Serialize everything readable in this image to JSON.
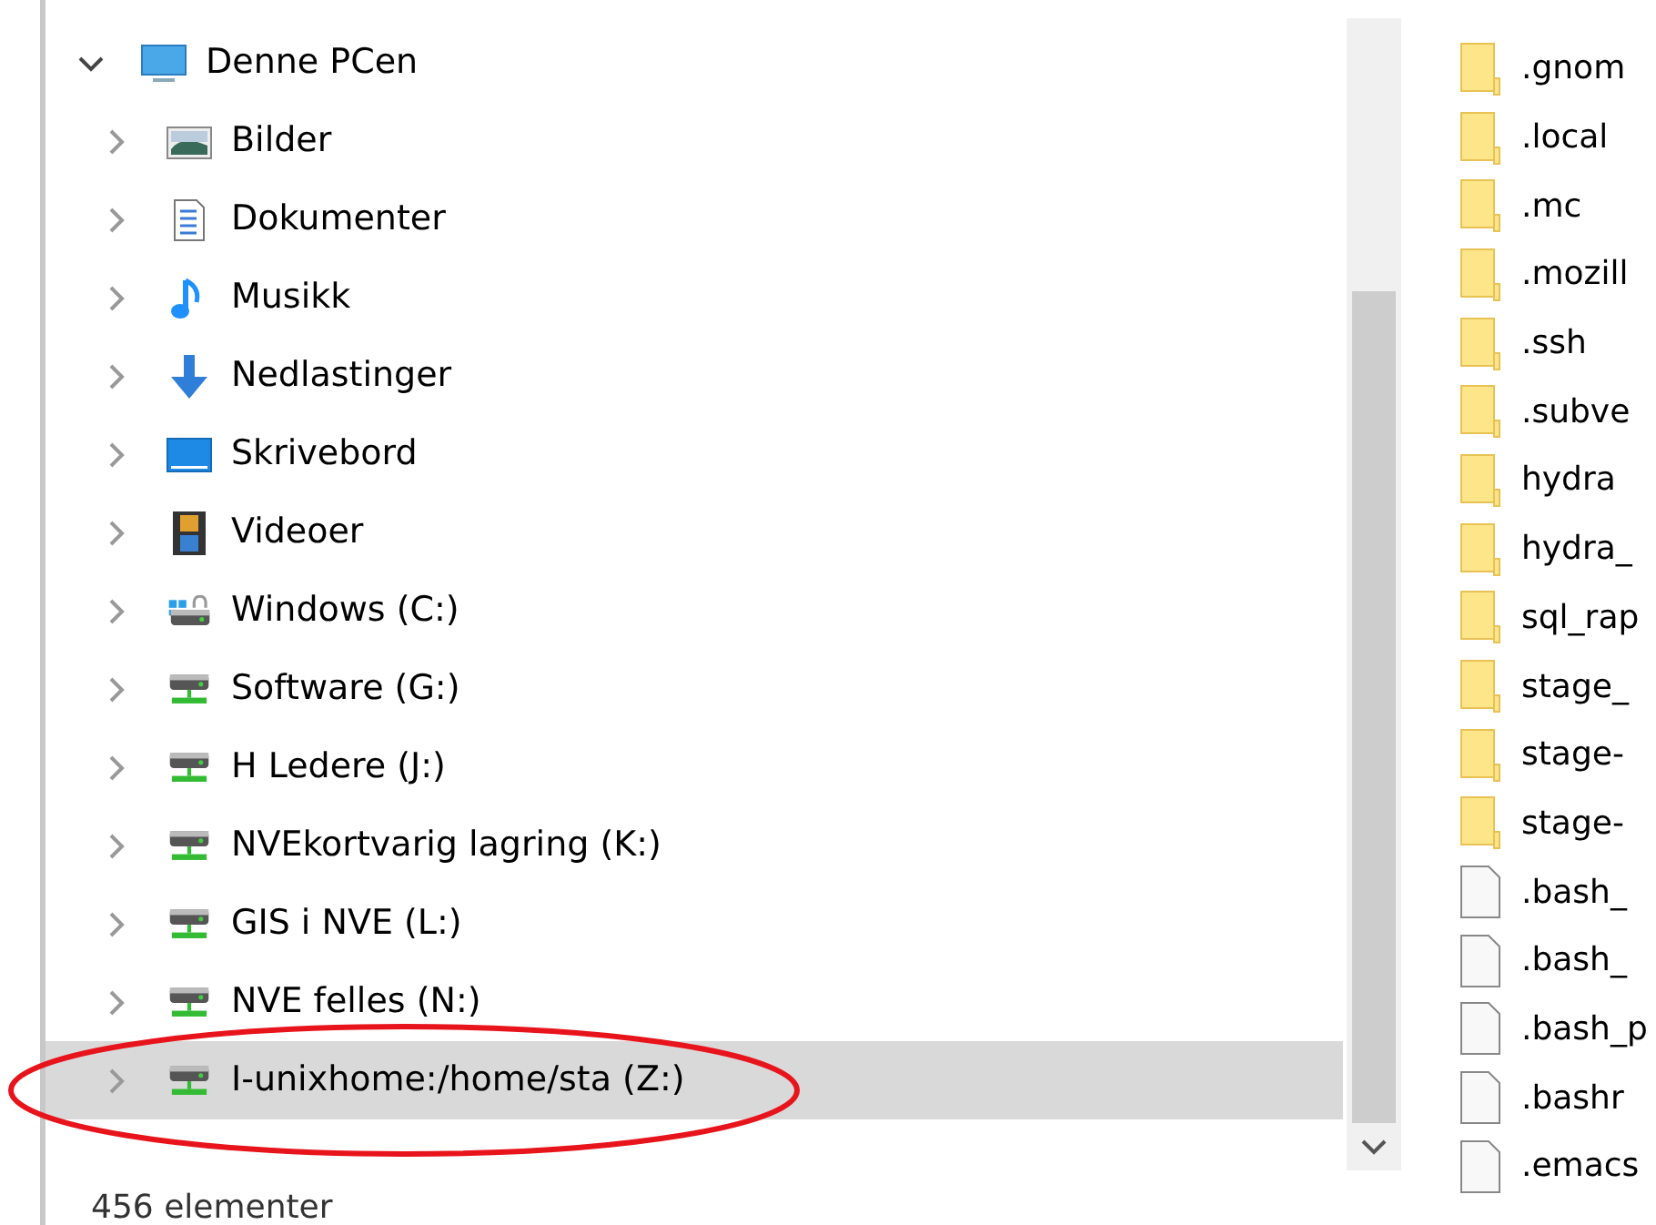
{
  "navigation_tree": {
    "label": "Denne PCen",
    "expanded": true,
    "children": [
      {
        "label": "Bilder",
        "kind": "pictures",
        "expanded": false,
        "selected": false
      },
      {
        "label": "Dokumenter",
        "kind": "documents",
        "expanded": false,
        "selected": false
      },
      {
        "label": "Musikk",
        "kind": "music",
        "expanded": false,
        "selected": false
      },
      {
        "label": "Nedlastinger",
        "kind": "downloads",
        "expanded": false,
        "selected": false
      },
      {
        "label": "Skrivebord",
        "kind": "desktop",
        "expanded": false,
        "selected": false
      },
      {
        "label": "Videoer",
        "kind": "videos",
        "expanded": false,
        "selected": false
      },
      {
        "label": "Windows (C:)",
        "kind": "system-drive",
        "expanded": false,
        "selected": false
      },
      {
        "label": "Software (G:)",
        "kind": "network-drive",
        "expanded": false,
        "selected": false
      },
      {
        "label": "H Ledere (J:)",
        "kind": "network-drive",
        "expanded": false,
        "selected": false
      },
      {
        "label": "NVEkortvarig lagring (K:)",
        "kind": "network-drive",
        "expanded": false,
        "selected": false
      },
      {
        "label": "GIS i NVE (L:)",
        "kind": "network-drive",
        "expanded": false,
        "selected": false
      },
      {
        "label": "NVE felles (N:)",
        "kind": "network-drive",
        "expanded": false,
        "selected": false
      },
      {
        "label": "I-unixhome:/home/sta (Z:)",
        "kind": "network-drive",
        "expanded": false,
        "selected": true
      }
    ]
  },
  "files": [
    {
      "name": ".gnom",
      "kind": "folder"
    },
    {
      "name": ".local",
      "kind": "folder"
    },
    {
      "name": ".mc",
      "kind": "folder"
    },
    {
      "name": ".mozill",
      "kind": "folder"
    },
    {
      "name": ".ssh",
      "kind": "folder"
    },
    {
      "name": ".subve",
      "kind": "folder"
    },
    {
      "name": "hydra",
      "kind": "folder"
    },
    {
      "name": "hydra_",
      "kind": "folder"
    },
    {
      "name": "sql_rap",
      "kind": "folder"
    },
    {
      "name": "stage_",
      "kind": "folder"
    },
    {
      "name": "stage-",
      "kind": "folder"
    },
    {
      "name": "stage-",
      "kind": "folder"
    },
    {
      "name": ".bash_",
      "kind": "file"
    },
    {
      "name": ".bash_",
      "kind": "file"
    },
    {
      "name": ".bash_p",
      "kind": "file"
    },
    {
      "name": ".bashr",
      "kind": "file"
    },
    {
      "name": ".emacs",
      "kind": "file"
    }
  ],
  "status_bar": "456 elementer"
}
